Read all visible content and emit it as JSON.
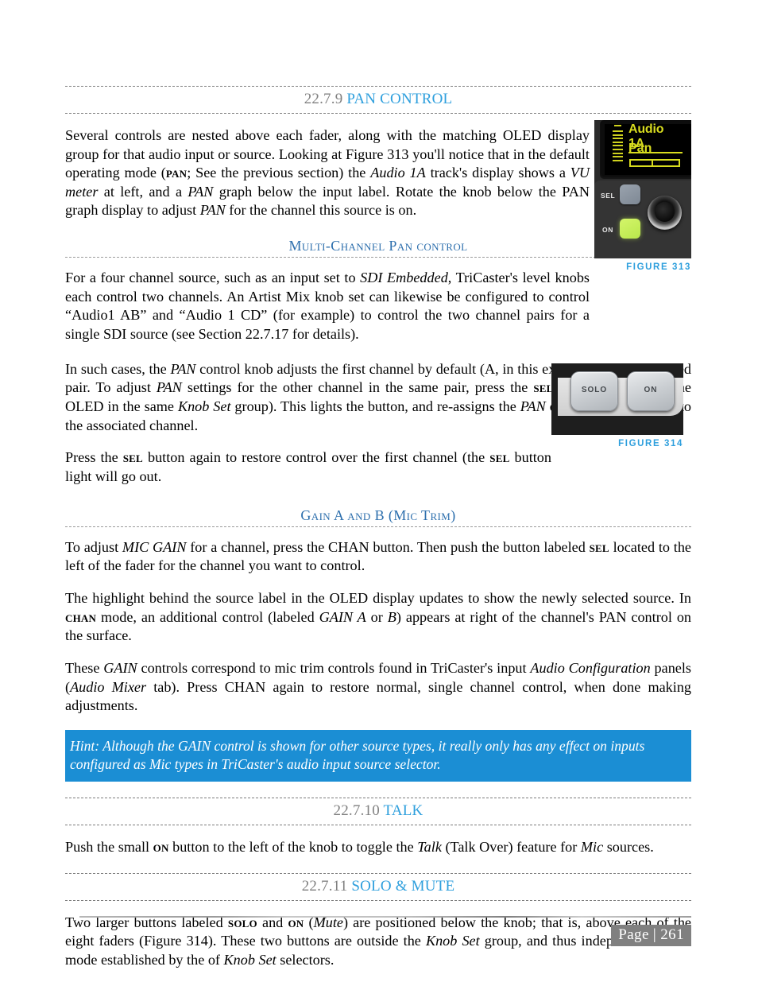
{
  "document": {
    "page_label": "Page | 261"
  },
  "sections": {
    "pan_control": {
      "number": "22.7.9",
      "title": "PAN CONTROL"
    },
    "talk": {
      "number": "22.7.10",
      "title": "TALK"
    },
    "solo_mute": {
      "number": "22.7.11",
      "title": "SOLO & MUTE"
    }
  },
  "subheads": {
    "multi_channel_pan": "Multi-Channel Pan control",
    "gain_a_b": "Gain A and B (Mic Trim)"
  },
  "paragraphs": {
    "p1_a": "Several controls are nested above each fader, along with the matching OLED display group for that audio input or source.  Looking at Figure 313 you'll notice that in the default operating mode (",
    "p1_pan_sc": "pan",
    "p1_b": "; See the previous section) the ",
    "p1_audio1a": "Audio 1A",
    "p1_c": " track's display shows a ",
    "p1_vumeter": "VU meter",
    "p1_d": " at left, and a ",
    "p1_pan2": "PAN",
    "p1_e": " graph below the input label. Rotate the knob below the PAN graph display to adjust ",
    "p1_pan3": "PAN",
    "p1_f": " for the channel this source is on.",
    "p2_a": "For a four channel source, such as an input set to ",
    "p2_sdi": "SDI Embedded",
    "p2_b": ", TriCaster's level knobs each control two channels. An Artist Mix knob set can likewise be configured to control “Audio1 AB” and “Audio 1 CD” (for example) to control the two channel pairs for a single SDI source (see Section 22.7.17 for details).",
    "p3_a": "In such cases, the ",
    "p3_pan": "PAN",
    "p3_b": " control knob adjusts the first channel by default (A, in this example) for the assigned pair. To adjust ",
    "p3_pan2": "PAN",
    "p3_c": " settings for the other channel in the same pair, press the ",
    "p3_sel": "sel",
    "p3_d": " button (just below the OLED in the same ",
    "p3_knobset": "Knob Set",
    "p3_e": " group). This lights the button, and re-assigns the ",
    "p3_pan3": "PAN",
    "p3_f": " control on the surface to the associated channel.",
    "p4_a": "Press the ",
    "p4_sel": "sel",
    "p4_b": " button again to restore control over the first channel (the ",
    "p4_sel2": "sel",
    "p4_c": " button light will go out.",
    "p5_a": "To adjust ",
    "p5_micgain": "MIC GAIN",
    "p5_b": " for a channel, press the CHAN button. Then push the button labeled ",
    "p5_sel": "sel",
    "p5_c": " located to the left of the fader for the channel you want to control.",
    "p6_a": "The highlight behind the source label in the OLED display updates to show the newly selected source. In ",
    "p6_chan": "chan",
    "p6_b": " mode, an additional control (labeled ",
    "p6_gaina": "GAIN A",
    "p6_c": " or ",
    "p6_b_it": "B",
    "p6_d": ") appears at right of the channel's PAN control on the surface.",
    "p7_a": "These ",
    "p7_gain": "GAIN",
    "p7_b": " controls correspond to mic trim controls found in TriCaster's input ",
    "p7_audioconfig": "Audio Configuration",
    "p7_c": " panels (",
    "p7_audiomixer": "Audio Mixer",
    "p7_d": " tab).  Press CHAN again to restore normal, single channel control, when done making adjustments.",
    "p8_a": "Push the small ",
    "p8_on": "on",
    "p8_b": " button to the left of the knob to toggle the ",
    "p8_talk": "Talk",
    "p8_c": " (Talk Over) feature for ",
    "p8_mic": "Mic",
    "p8_d": " sources.",
    "p9_a": "Two larger buttons labeled ",
    "p9_solo": "solo",
    "p9_b": " and ",
    "p9_on": "on",
    "p9_c": " (",
    "p9_mute": "Mute",
    "p9_d": ") are positioned below the knob; that is, above each of the eight faders (Figure 314).  These two buttons are outside the ",
    "p9_knobset": "Knob Set",
    "p9_e": " group, and thus independent of the mode established by the of ",
    "p9_knobset2": "Knob Set",
    "p9_f": " selectors."
  },
  "hint": {
    "text": "Hint:  Although the GAIN control is shown for other source types, it really only has any effect on inputs configured as Mic types in TriCaster's audio input source selector.",
    "background_color": "#1b8ed4",
    "text_color": "#ffffff"
  },
  "figures": {
    "fig313": {
      "caption": "FIGURE 313",
      "oled_label": "Audio 1A",
      "oled_mode": "Pan",
      "button_sel": "SEL",
      "button_on": "ON",
      "oled_text_color": "#d8dc1f",
      "on_button_color": "#c9ef5a"
    },
    "fig314": {
      "caption": "FIGURE 314",
      "button_solo": "SOLO",
      "button_on": "ON"
    }
  },
  "colors": {
    "heading_blue": "#2e9fdd",
    "subhead_blue": "#2d6fad",
    "heading_number_gray": "#808080",
    "footer_gray": "#808080"
  }
}
